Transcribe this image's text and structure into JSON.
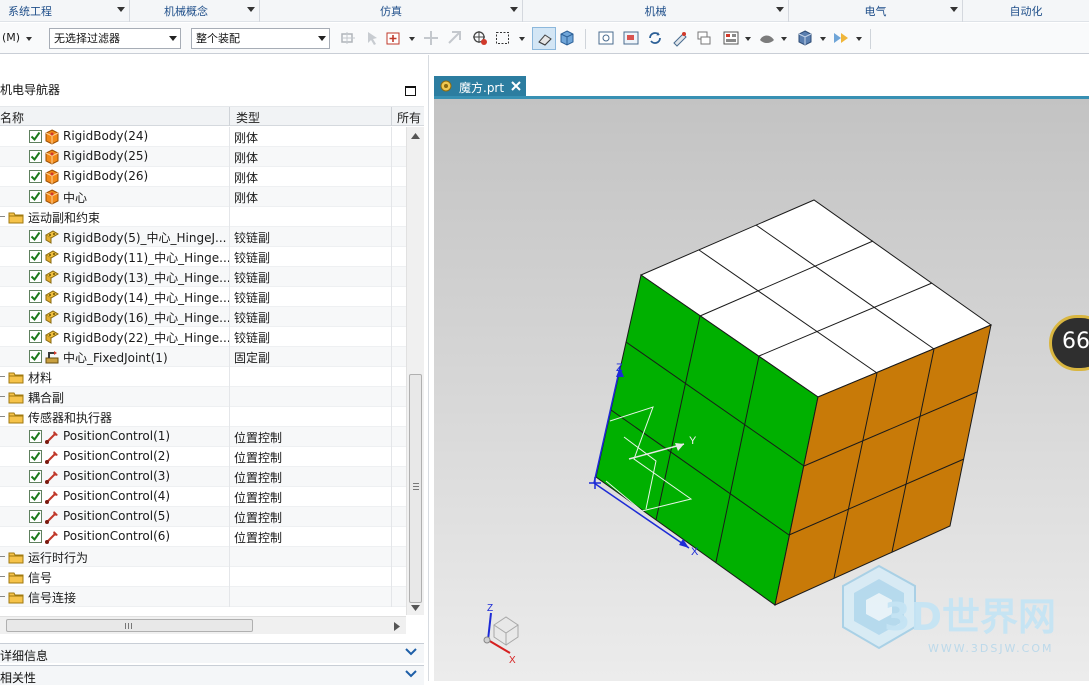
{
  "ribbon_groups": [
    {
      "label": "系统工程"
    },
    {
      "label": "机械概念"
    },
    {
      "label": "仿真"
    },
    {
      "label": "机械"
    },
    {
      "label": "电气"
    },
    {
      "label": "自动化"
    }
  ],
  "toolbar": {
    "menu_label": "(M)",
    "filter_value": "无选择过滤器",
    "assembly_value": "整个装配"
  },
  "navigator": {
    "title": "机电导航器",
    "columns": [
      "名称",
      "类型",
      "所有"
    ],
    "rows": [
      {
        "name": "RigidBody(24)",
        "type": "刚体",
        "kind": "body",
        "checked": true
      },
      {
        "name": "RigidBody(25)",
        "type": "刚体",
        "kind": "body",
        "checked": true
      },
      {
        "name": "RigidBody(26)",
        "type": "刚体",
        "kind": "body",
        "checked": true
      },
      {
        "name": "中心",
        "type": "刚体",
        "kind": "body",
        "checked": true
      },
      {
        "name": "运动副和约束",
        "type": "",
        "kind": "folder",
        "checked": false
      },
      {
        "name": "RigidBody(5)_中心_HingeJ...",
        "type": "铰链副",
        "kind": "hinge",
        "checked": true
      },
      {
        "name": "RigidBody(11)_中心_Hinge...",
        "type": "铰链副",
        "kind": "hinge",
        "checked": true
      },
      {
        "name": "RigidBody(13)_中心_Hinge...",
        "type": "铰链副",
        "kind": "hinge",
        "checked": true
      },
      {
        "name": "RigidBody(14)_中心_Hinge...",
        "type": "铰链副",
        "kind": "hinge",
        "checked": true
      },
      {
        "name": "RigidBody(16)_中心_Hinge...",
        "type": "铰链副",
        "kind": "hinge",
        "checked": true
      },
      {
        "name": "RigidBody(22)_中心_Hinge...",
        "type": "铰链副",
        "kind": "hinge",
        "checked": true
      },
      {
        "name": "中心_FixedJoint(1)",
        "type": "固定副",
        "kind": "fixed",
        "checked": true
      },
      {
        "name": "材料",
        "type": "",
        "kind": "folder",
        "checked": false
      },
      {
        "name": "耦合副",
        "type": "",
        "kind": "folder",
        "checked": false
      },
      {
        "name": "传感器和执行器",
        "type": "",
        "kind": "folder",
        "checked": false
      },
      {
        "name": "PositionControl(1)",
        "type": "位置控制",
        "kind": "control",
        "checked": true
      },
      {
        "name": "PositionControl(2)",
        "type": "位置控制",
        "kind": "control",
        "checked": true
      },
      {
        "name": "PositionControl(3)",
        "type": "位置控制",
        "kind": "control",
        "checked": true
      },
      {
        "name": "PositionControl(4)",
        "type": "位置控制",
        "kind": "control",
        "checked": true
      },
      {
        "name": "PositionControl(5)",
        "type": "位置控制",
        "kind": "control",
        "checked": true
      },
      {
        "name": "PositionControl(6)",
        "type": "位置控制",
        "kind": "control",
        "checked": true
      },
      {
        "name": "运行时行为",
        "type": "",
        "kind": "folder",
        "checked": false
      },
      {
        "name": "信号",
        "type": "",
        "kind": "folder",
        "checked": false
      },
      {
        "name": "信号连接",
        "type": "",
        "kind": "folder",
        "checked": false
      }
    ],
    "details_label": "详细信息",
    "deps_label": "相关性"
  },
  "viewport": {
    "tab_label": "魔方.prt",
    "axis_labels": {
      "z": "Z",
      "y": "Y",
      "x": "X"
    },
    "badge_text": "66",
    "watermark_main": "3D世界网",
    "watermark_sub": "WWW.3DSJW.COM"
  },
  "colors": {
    "cube_top": "#ffffff",
    "cube_left": "#00b000",
    "cube_right": "#c87a08",
    "tab_bg": "#2c7da0"
  }
}
